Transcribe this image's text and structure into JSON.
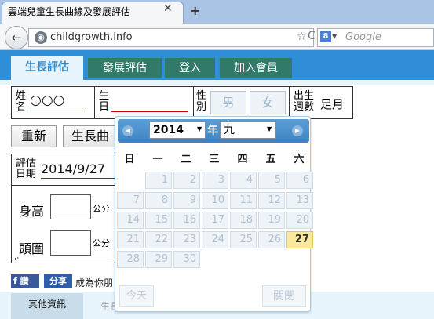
{
  "browser": {
    "tab_title": "雲端兒童生長曲線及發展評估",
    "tab_close": "✕",
    "new_tab": "+",
    "back": "←",
    "globe": "◉",
    "url": "childgrowth.info",
    "star": "☆",
    "reload": "C",
    "search_engine": "8",
    "search_placeholder": "Google"
  },
  "site_nav": {
    "tabs": [
      {
        "label": "生長評估",
        "active": true
      },
      {
        "label": "發展評估",
        "active": false
      },
      {
        "label": "登入",
        "active": false
      },
      {
        "label": "加入會員",
        "active": false
      }
    ]
  },
  "form": {
    "name_label": "姓名",
    "name_value": "○○○",
    "birthday_label": "生日",
    "sex_label": "性別",
    "male": "男",
    "female": "女",
    "ga_label": "出生週數",
    "ga_value": "足月",
    "reset_button": "重新",
    "curve_button": "生長曲",
    "eval_date_label": "評估日期",
    "eval_date_value": "2014/9/27",
    "height_label": "身高",
    "height_unit": "公分",
    "head_label": "頭圍",
    "head_unit": "公分",
    "crlf": "↵"
  },
  "social": {
    "fb_label": "f 讚",
    "share_label": "分享",
    "fan_text": "成為你朋"
  },
  "bottom_tabs": {
    "other_info": "其他資訊",
    "growth2": "生長"
  },
  "datepicker": {
    "prev": "◀",
    "next": "▶",
    "year": "2014",
    "year_unit": "年",
    "month": "九",
    "weekdays": [
      "日",
      "一",
      "二",
      "三",
      "四",
      "五",
      "六"
    ],
    "weeks": [
      [
        "",
        "1",
        "2",
        "3",
        "4",
        "5",
        "6"
      ],
      [
        "7",
        "8",
        "9",
        "10",
        "11",
        "12",
        "13"
      ],
      [
        "14",
        "15",
        "16",
        "17",
        "18",
        "19",
        "20"
      ],
      [
        "21",
        "22",
        "23",
        "24",
        "25",
        "26",
        "27"
      ],
      [
        "28",
        "29",
        "30",
        "",
        "",
        "",
        ""
      ]
    ],
    "selected_day": "27",
    "today_button": "今天",
    "close_button": "關閉"
  }
}
